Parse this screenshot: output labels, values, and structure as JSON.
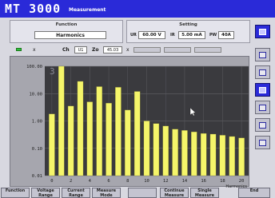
{
  "header": {
    "title": "MT 3000",
    "subtitle": "Measurement"
  },
  "function_panel": {
    "label": "Function",
    "value": "Harmonics"
  },
  "setting_panel": {
    "label": "Setting",
    "u_tag": "UR",
    "u_value": "60.00 V",
    "i_tag": "IR",
    "i_value": "5.00 mA",
    "pw_tag": "PW",
    "pw_value": "40A"
  },
  "controls": {
    "x_mark": "x",
    "ch_label": "Ch",
    "ch_value": "U1",
    "zo_label": "Zo",
    "zo_value": "45.03",
    "x2_mark": "x"
  },
  "colors": {
    "title_bg": "#2a2ad8",
    "bar": "#f5f56a",
    "plot_bg": "#3a3a3e"
  },
  "side_buttons": [
    {
      "icon": "harmonics-icon",
      "active": true
    },
    {
      "icon": "graph-icon",
      "active": false
    },
    {
      "icon": "table-icon",
      "active": false
    },
    {
      "icon": "scope-icon",
      "active": true
    },
    {
      "icon": "cursor-icon",
      "active": false
    },
    {
      "icon": "printer-icon",
      "active": false
    },
    {
      "icon": "settings-icon",
      "active": false
    }
  ],
  "softkeys": [
    {
      "line1": "Function",
      "line2": ""
    },
    {
      "line1": "Voltage",
      "line2": "Range"
    },
    {
      "line1": "Current",
      "line2": "Range"
    },
    {
      "line1": "Measure",
      "line2": "Mode"
    },
    {
      "line1": "",
      "line2": ""
    },
    {
      "line1": "Continue",
      "line2": "Measure"
    },
    {
      "line1": "Single",
      "line2": "Measure"
    },
    {
      "line1": "End",
      "line2": ""
    }
  ],
  "chart_data": {
    "type": "bar",
    "xlabel": "Harmonics",
    "y_scale": "log",
    "ylim": [
      0.01,
      100
    ],
    "y_ticks": [
      "100.00",
      "10.00",
      "1.00",
      "0.10",
      "0.01"
    ],
    "x_ticks": [
      "0",
      "2",
      "4",
      "6",
      "8",
      "10",
      "12",
      "14",
      "16",
      "18",
      "20"
    ],
    "x": [
      0,
      1,
      2,
      3,
      4,
      5,
      6,
      7,
      8,
      9,
      10,
      11,
      12,
      13,
      14,
      15,
      16,
      17,
      18,
      19,
      20
    ],
    "values": [
      1.8,
      100,
      3.5,
      28,
      5,
      18,
      4.5,
      17,
      2.5,
      12,
      1,
      0.8,
      0.65,
      0.5,
      0.45,
      0.4,
      0.35,
      0.33,
      0.3,
      0.27,
      0.24
    ],
    "marker_label": "3"
  }
}
